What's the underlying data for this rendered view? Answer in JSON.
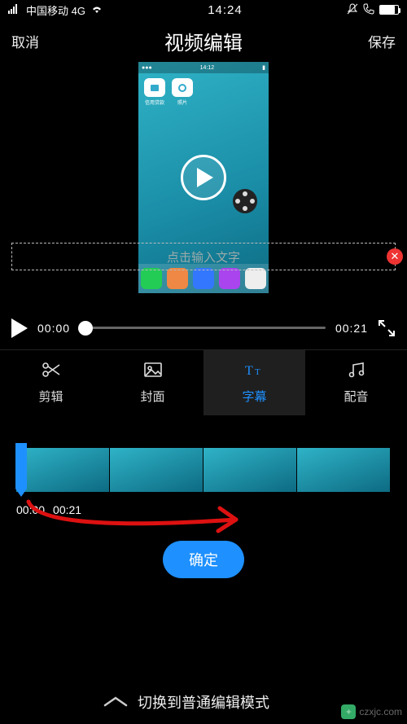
{
  "status": {
    "carrier": "中国移动 4G",
    "time": "14:24"
  },
  "header": {
    "cancel": "取消",
    "title": "视频编辑",
    "save": "保存"
  },
  "preview": {
    "textPlaceholder": "点击输入文字",
    "innerStatusTime": "14:12",
    "appIcons": [
      "信用贷款",
      "照片"
    ]
  },
  "playback": {
    "current": "00:00",
    "total": "00:21"
  },
  "tabs": [
    {
      "key": "trim",
      "label": "剪辑"
    },
    {
      "key": "cover",
      "label": "封面"
    },
    {
      "key": "subtitle",
      "label": "字幕"
    },
    {
      "key": "audio",
      "label": "配音"
    }
  ],
  "activeTab": "subtitle",
  "timeline": {
    "start": "00:00",
    "end": "00:21"
  },
  "confirmLabel": "确定",
  "bottomToggle": "切换到普通编辑模式",
  "watermark": "czxjc.com"
}
